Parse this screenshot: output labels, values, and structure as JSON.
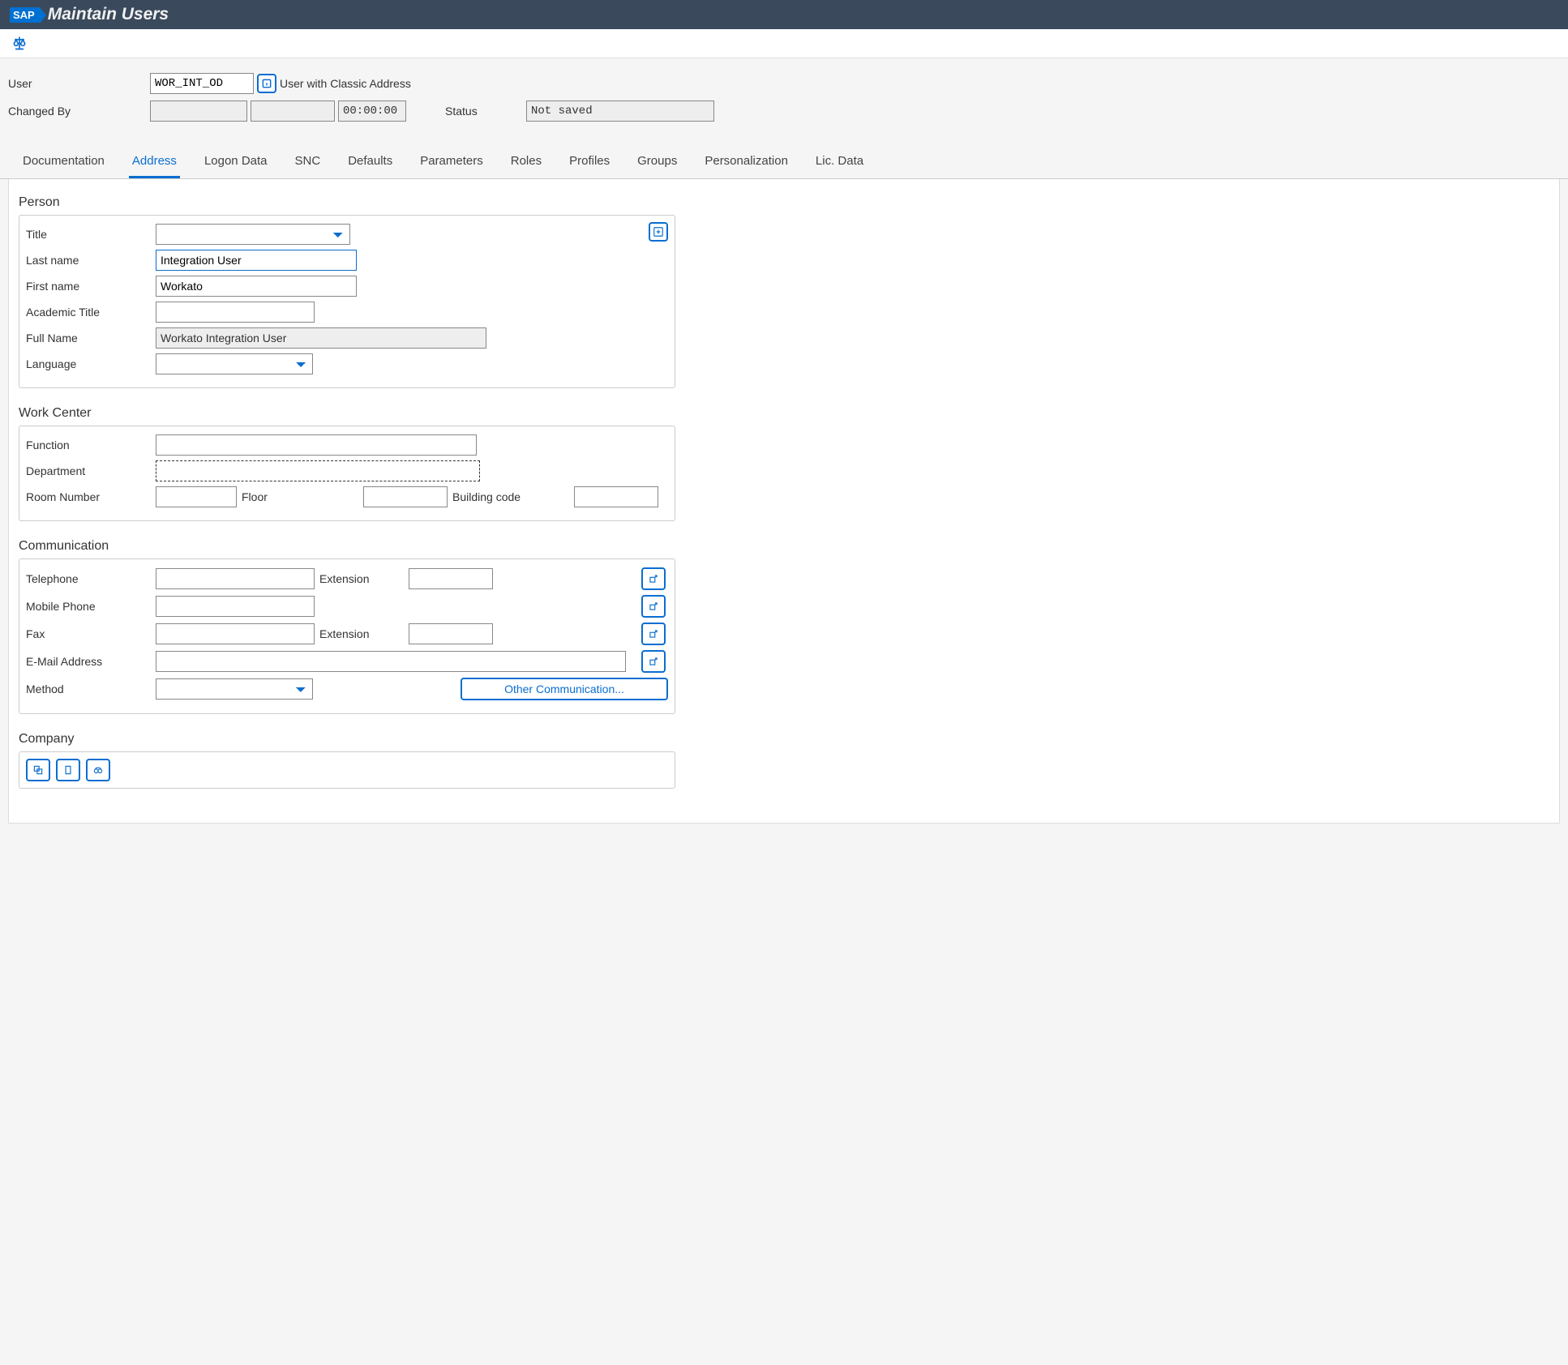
{
  "titlebar": {
    "logo": "SAP",
    "title": "Maintain Users"
  },
  "header": {
    "user_label": "User",
    "user_value": "WOR_INT_OD",
    "user_classic_label": "User with Classic Address",
    "changed_by_label": "Changed By",
    "changed_by_value": "",
    "changed_on_value": "",
    "changed_time_value": "00:00:00",
    "status_label": "Status",
    "status_value": "Not saved"
  },
  "tabs": [
    "Documentation",
    "Address",
    "Logon Data",
    "SNC",
    "Defaults",
    "Parameters",
    "Roles",
    "Profiles",
    "Groups",
    "Personalization",
    "Lic. Data"
  ],
  "active_tab": "Address",
  "person": {
    "section": "Person",
    "title_label": "Title",
    "title_value": "",
    "last_name_label": "Last name",
    "last_name_value": "Integration User",
    "first_name_label": "First name",
    "first_name_value": "Workato",
    "academic_label": "Academic Title",
    "academic_value": "",
    "full_name_label": "Full Name",
    "full_name_value": "Workato Integration User",
    "language_label": "Language",
    "language_value": ""
  },
  "workcenter": {
    "section": "Work Center",
    "function_label": "Function",
    "function_value": "",
    "department_label": "Department",
    "department_value": "",
    "room_label": "Room Number",
    "room_value": "",
    "floor_label": "Floor",
    "floor_value": "",
    "building_label": "Building code",
    "building_value": ""
  },
  "comm": {
    "section": "Communication",
    "telephone_label": "Telephone",
    "telephone_value": "",
    "ext1_label": "Extension",
    "ext1_value": "",
    "mobile_label": "Mobile Phone",
    "mobile_value": "",
    "fax_label": "Fax",
    "fax_value": "",
    "ext2_label": "Extension",
    "ext2_value": "",
    "email_label": "E-Mail Address",
    "email_value": "",
    "method_label": "Method",
    "method_value": "",
    "other_btn": "Other Communication..."
  },
  "company": {
    "section": "Company"
  }
}
